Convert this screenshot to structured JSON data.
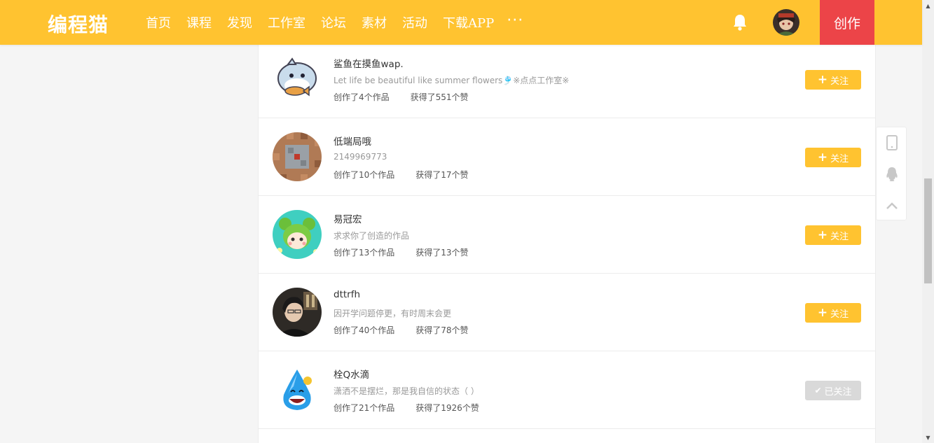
{
  "header": {
    "logo": "编程猫",
    "nav": [
      "首页",
      "课程",
      "发现",
      "工作室",
      "论坛",
      "素材",
      "活动",
      "下载APP"
    ],
    "more": "···",
    "create_label": "创作"
  },
  "users": [
    {
      "name": "鲨鱼在摸鱼wap.",
      "desc": "Let life be beautiful like summer flowers🎐※点点工作室※",
      "works": "创作了4个作品",
      "likes": "获得了551个赞",
      "follow_label": "关注",
      "followed": false,
      "avatar": "shark-avatar"
    },
    {
      "name": "低端局哦",
      "desc": "2149969773",
      "works": "创作了10个作品",
      "likes": "获得了17个赞",
      "follow_label": "关注",
      "followed": false,
      "avatar": "pixel-block-avatar"
    },
    {
      "name": "易冠宏",
      "desc": "求求你了创造的作品",
      "works": "创作了13个作品",
      "likes": "获得了13个赞",
      "follow_label": "关注",
      "followed": false,
      "avatar": "green-bear-avatar"
    },
    {
      "name": "dttrfh",
      "desc": "因开学问题停更，有时周末会更",
      "works": "创作了40个作品",
      "likes": "获得了78个赞",
      "follow_label": "关注",
      "followed": false,
      "avatar": "portrait-avatar"
    },
    {
      "name": "栓Q水滴",
      "desc": "潇洒不是摆烂，那是我自信的状态（ ）",
      "works": "创作了21个作品",
      "likes": "获得了1926个赞",
      "follow_label": "已关注",
      "followed": true,
      "avatar": "water-drop-avatar"
    }
  ],
  "colors": {
    "brand": "#ffc330",
    "create": "#ec4448",
    "followed": "#d9d9d9"
  }
}
